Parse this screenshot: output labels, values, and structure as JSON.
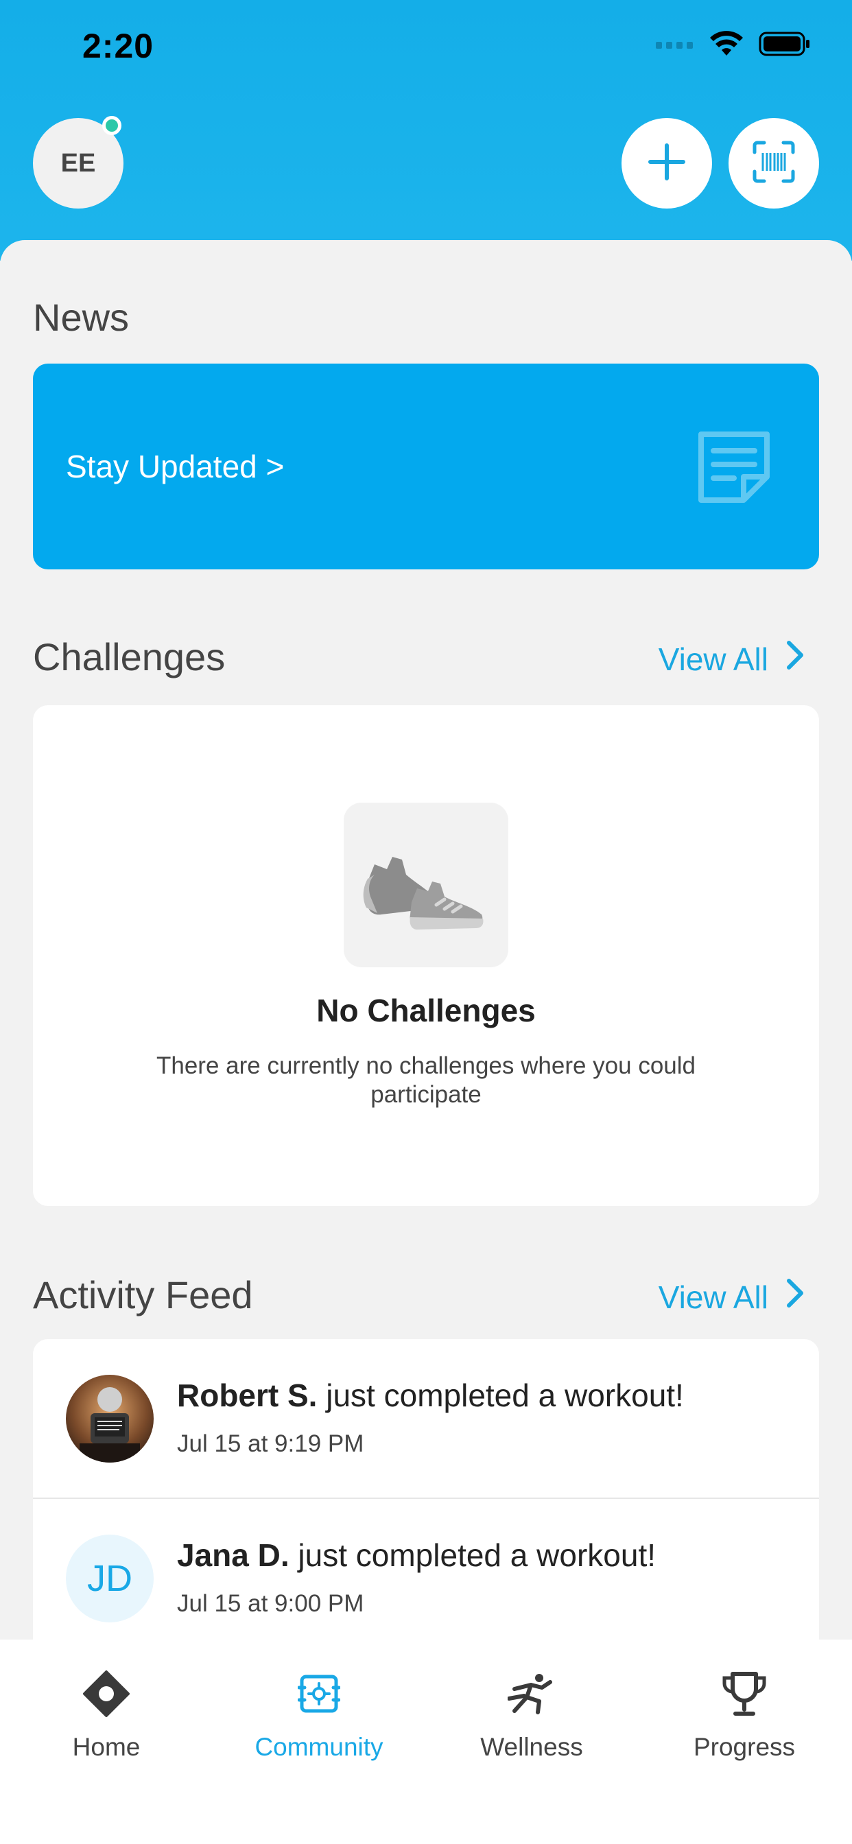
{
  "status_bar": {
    "time": "2:20"
  },
  "header": {
    "avatar_initials": "EE"
  },
  "news": {
    "title": "News",
    "card_text": "Stay Updated >"
  },
  "challenges": {
    "title": "Challenges",
    "view_all": "View All",
    "empty_title": "No Challenges",
    "empty_description": "There are currently no challenges where you could participate"
  },
  "activity_feed": {
    "title": "Activity Feed",
    "view_all": "View All",
    "items": [
      {
        "name": "Robert S.",
        "action": " just completed a workout!",
        "time": "Jul 15 at 9:19 PM",
        "avatar": "photo"
      },
      {
        "name": "Jana D.",
        "action": " just completed a workout!",
        "time": "Jul 15 at 9:00 PM",
        "avatar_initials": "JD"
      }
    ]
  },
  "tabs": [
    {
      "label": "Home",
      "icon": "home-diamond-icon",
      "active": false
    },
    {
      "label": "Community",
      "icon": "community-icon",
      "active": true
    },
    {
      "label": "Wellness",
      "icon": "running-person-icon",
      "active": false
    },
    {
      "label": "Progress",
      "icon": "trophy-icon",
      "active": false
    }
  ],
  "colors": {
    "brand_blue": "#14aee8",
    "accent_blue": "#19a8e6",
    "presence_green": "#2cc8a8"
  }
}
